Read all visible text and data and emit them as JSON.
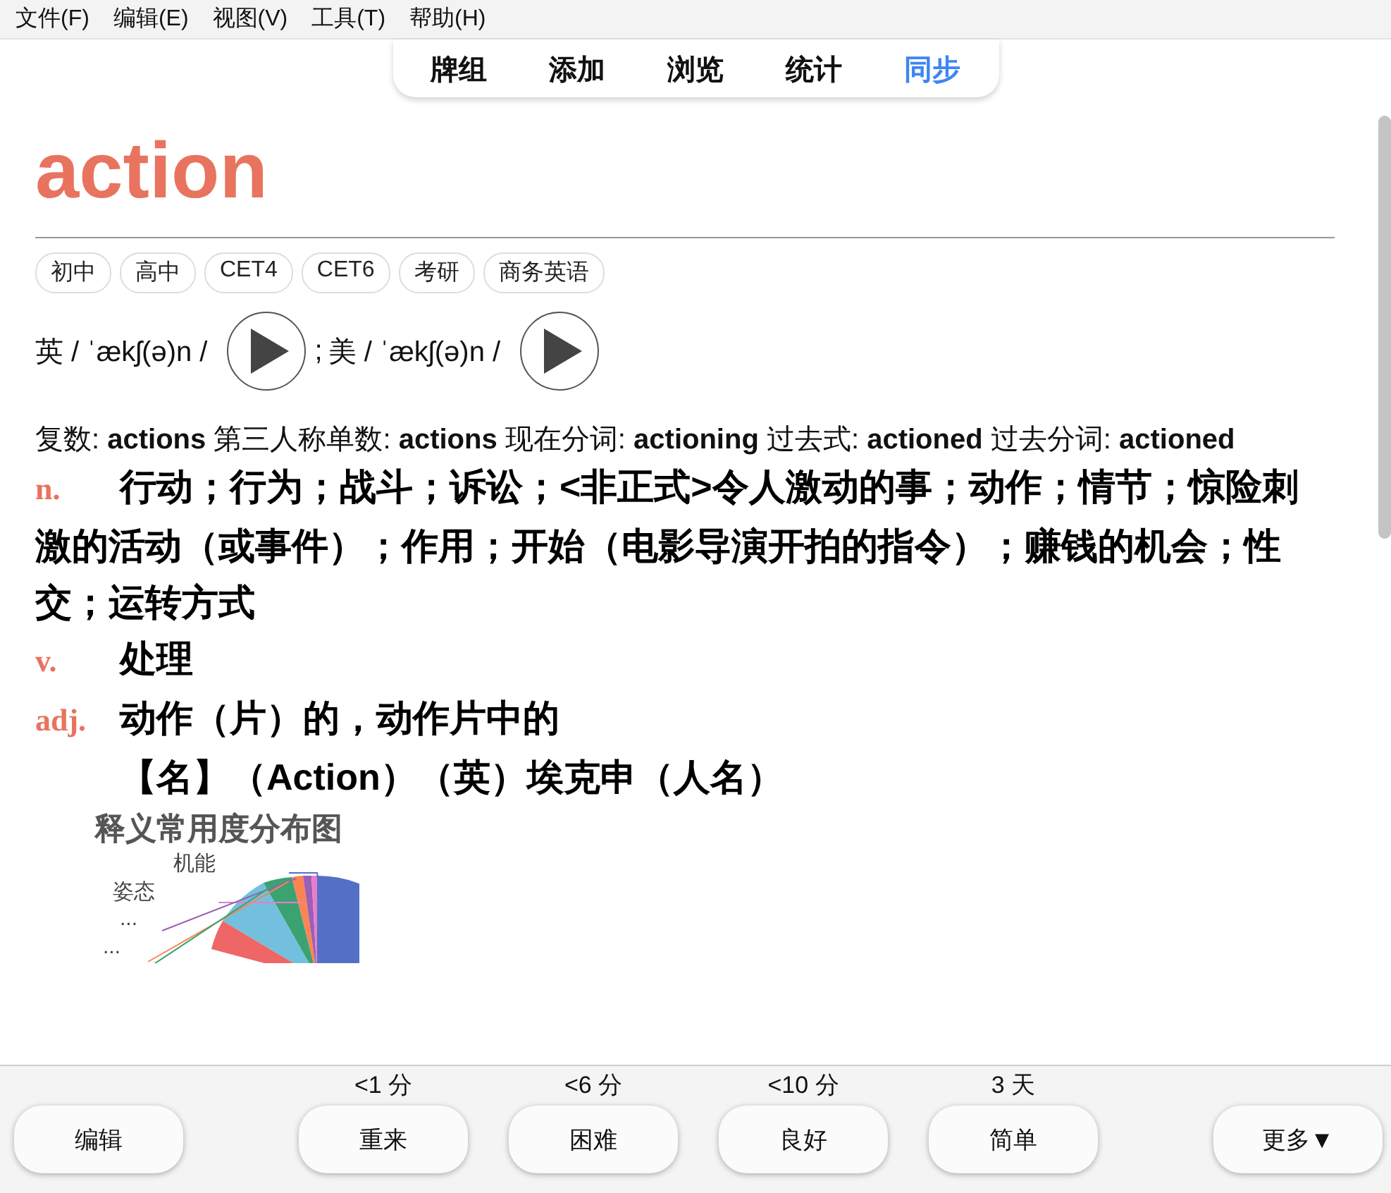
{
  "menu": [
    "文件(F)",
    "编辑(E)",
    "视图(V)",
    "工具(T)",
    "帮助(H)"
  ],
  "tabs": [
    {
      "label": "牌组",
      "selected": false
    },
    {
      "label": "添加",
      "selected": false
    },
    {
      "label": "浏览",
      "selected": false
    },
    {
      "label": "统计",
      "selected": false
    },
    {
      "label": "同步",
      "selected": true
    }
  ],
  "word": "action",
  "tags": [
    "初中",
    "高中",
    "CET4",
    "CET6",
    "考研",
    "商务英语"
  ],
  "pronunciations": [
    {
      "label": "英 / ˈækʃ(ə)n /"
    },
    {
      "label": "美 / ˈækʃ(ə)n /",
      "separator": ";"
    }
  ],
  "forms": "复数: **actions** 第三人称单数: **actions** 现在分词: **actioning** 过去式: **actioned** 过去分词: **actioned**",
  "definitions": [
    {
      "pos": "n.",
      "text": "行动；行为；战斗；诉讼；<非正式>令人激动的事；动作；情节；惊险刺激的活动（或事件）；作用；开始（电影导演开拍的指令）；赚钱的机会；性交；运转方式"
    },
    {
      "pos": "v.",
      "text": "处理"
    },
    {
      "pos": "adj.",
      "text": "动作（片）的，动作片中的"
    },
    {
      "text": "【名】（Action）（英）埃克申（人名）"
    }
  ],
  "chart": {
    "title": "释义常用度分布图",
    "labels": [
      "机能",
      "姿态",
      "...",
      "..."
    ]
  },
  "answer_times": [
    "<1 分",
    "<6 分",
    "<10 分",
    "3 天"
  ],
  "buttons": {
    "edit": "编辑",
    "answers": [
      "重来",
      "困难",
      "良好",
      "简单"
    ],
    "more": "更多▼"
  }
}
